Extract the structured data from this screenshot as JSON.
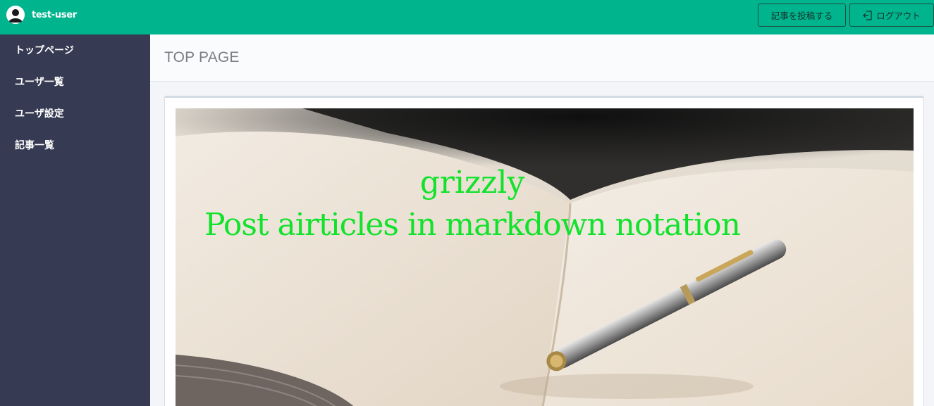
{
  "header": {
    "username": "test-user",
    "post_button": "記事を投稿する",
    "logout_button": "ログアウト"
  },
  "sidebar": {
    "items": [
      {
        "label": "トップページ"
      },
      {
        "label": "ユーザ一覧"
      },
      {
        "label": "ユーザ設定"
      },
      {
        "label": "記事一覧"
      }
    ]
  },
  "main": {
    "title": "TOP PAGE",
    "hero": {
      "title": "grizzly",
      "subtitle": "Post airticles in markdown notation"
    }
  },
  "colors": {
    "topbar": "#00b48e",
    "sidebar": "#363a52",
    "hero_text": "#11e22b"
  }
}
